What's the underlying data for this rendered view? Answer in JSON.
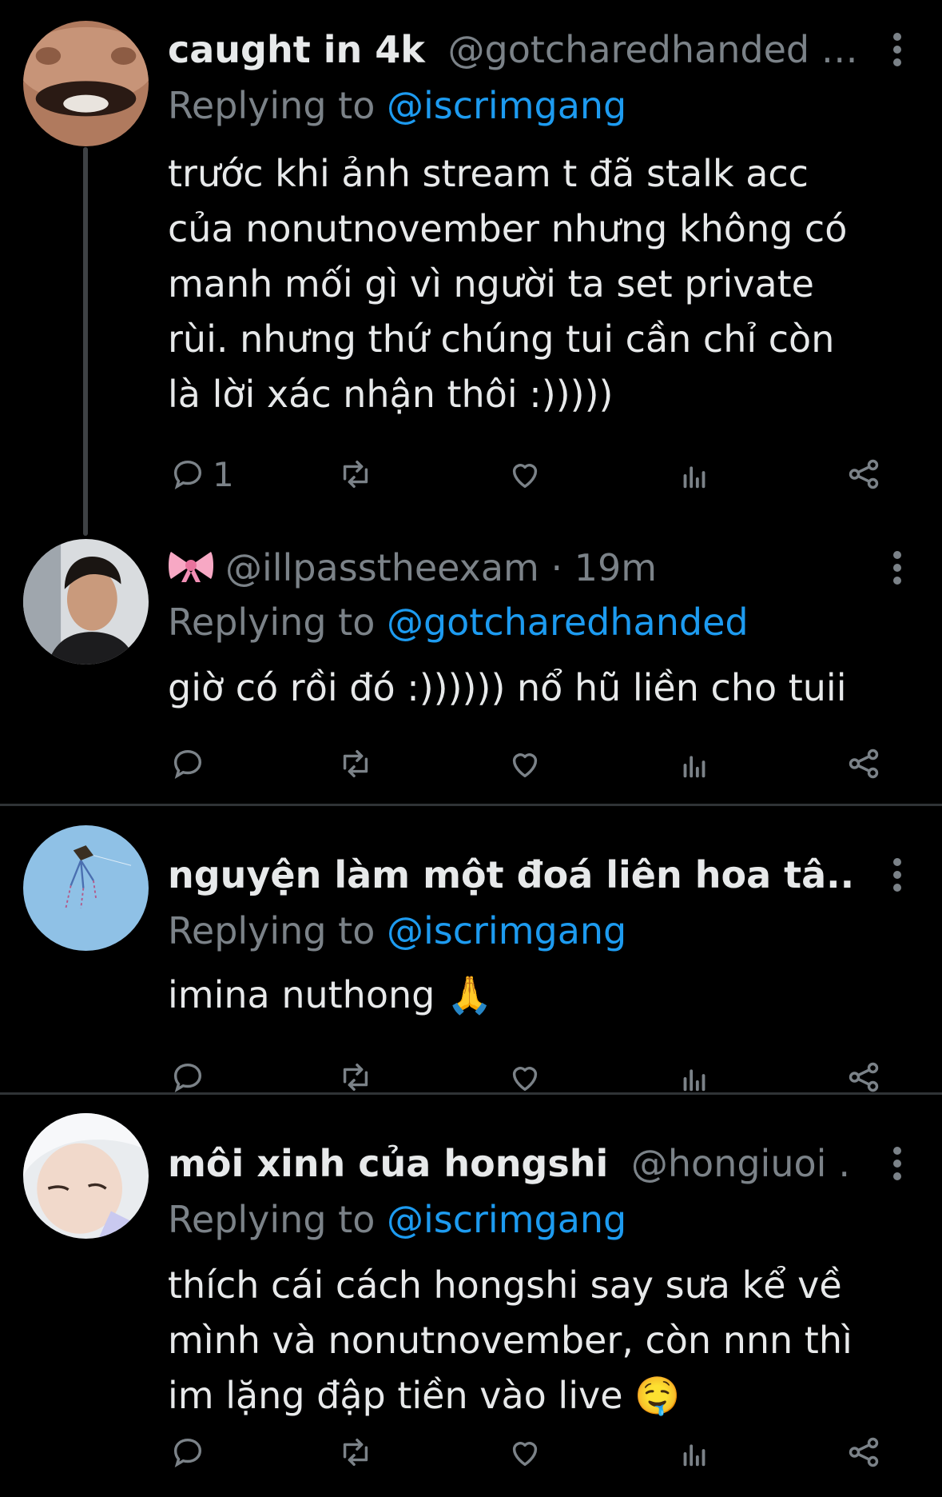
{
  "tweets": [
    {
      "display_name": "caught in 4k",
      "handle": "@gotcharedhanded …",
      "replying_prefix": "Replying to ",
      "replying_to": "@iscrimgang",
      "text": "trước khi ảnh stream t đã stalk acc\ncủa nonutnovember nhưng không có\nmanh mối gì vì người ta set private\nrùi. nhưng thứ chúng tui cần chỉ còn\nlà lời xác nhận thôi :)))))",
      "reply_count": "1",
      "avatar": "face-closeup-avatar"
    },
    {
      "display_name": "",
      "emoji": "ribbon-emoji",
      "handle": "@illpasstheexam · 19m",
      "replying_prefix": "Replying to ",
      "replying_to": "@gotcharedhanded",
      "text": "giờ có rồi đó :)))))) nổ hũ liền cho tuii",
      "reply_count": "",
      "avatar": "man-portrait-avatar"
    },
    {
      "display_name": "nguyện làm một đoá liên hoa tâ...",
      "handle": "",
      "replying_prefix": "Replying to ",
      "replying_to": "@iscrimgang",
      "text": "imina nuthong 🙏",
      "reply_count": "",
      "avatar": "kite-sky-avatar"
    },
    {
      "display_name": "môi xinh của hongshi",
      "handle": "@hongiuoi …",
      "replying_prefix": "Replying to ",
      "replying_to": "@iscrimgang",
      "text": "thích cái cách hongshi say sưa kể về\nmình và nonutnovember, còn nnn thì\nim lặng đập tiền vào live 🤤",
      "reply_count": "",
      "avatar": "selfie-avatar"
    }
  ],
  "icons": [
    "more-vertical-icon",
    "reply-icon",
    "retweet-icon",
    "like-icon",
    "views-icon",
    "share-icon"
  ],
  "colors": {
    "background": "#000000",
    "text": "#e7e9ea",
    "muted": "#7b8288",
    "link": "#1d9bf0",
    "divider": "#2f3336"
  }
}
